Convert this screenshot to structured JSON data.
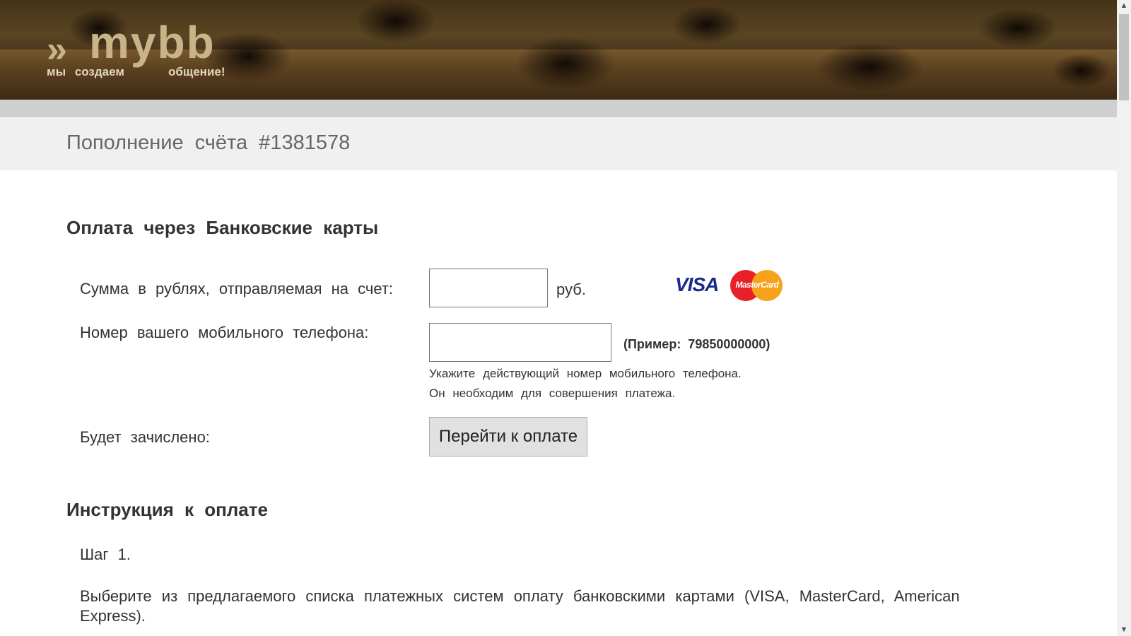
{
  "header": {
    "logo_word": "mybb",
    "logo_arrows": "»",
    "tagline_left": "мы создаем",
    "tagline_right": "общение!"
  },
  "page_title": "Пополнение счёта #1381578",
  "bank_cards": {
    "section_title": "Оплата через Банковские карты",
    "amount_label": "Сумма в рублях, отправляемая на счет:",
    "amount_value": "",
    "amount_unit": "руб.",
    "visa_logo": "VISA",
    "mastercard_logo": "MasterCard",
    "phone_label": "Номер вашего мобильного телефона:",
    "phone_value": "",
    "phone_example": "(Пример: 79850000000)",
    "phone_hint_line1": "Укажите действующий номер мобильного телефона.",
    "phone_hint_line2": "Он необходим для совершения платежа.",
    "credited_label": "Будет зачислено:",
    "pay_button": "Перейти к оплате"
  },
  "instructions": {
    "section_title": "Инструкция к оплате",
    "step1_title": "Шаг 1.",
    "step1_text": "Выберите из предлагаемого списка платежных систем оплату банковскими картами (VISA, MasterCard, American Express)."
  },
  "scrollbar": {
    "up_icon": "chevron-up-icon",
    "down_icon": "chevron-down-icon"
  }
}
